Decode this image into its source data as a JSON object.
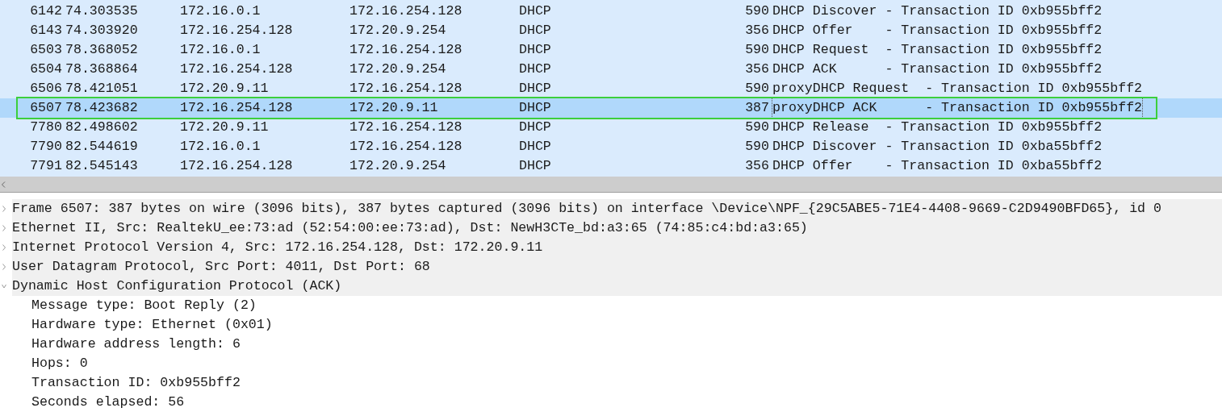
{
  "packet_list": {
    "rows": [
      {
        "no": "6142",
        "time": "74.303535",
        "source": "172.16.0.1",
        "destination": "172.16.254.128",
        "protocol": "DHCP",
        "length": "590",
        "info": "DHCP Discover - Transaction ID 0xb955bff2",
        "selected": false
      },
      {
        "no": "6143",
        "time": "74.303920",
        "source": "172.16.254.128",
        "destination": "172.20.9.254",
        "protocol": "DHCP",
        "length": "356",
        "info": "DHCP Offer    - Transaction ID 0xb955bff2",
        "selected": false
      },
      {
        "no": "6503",
        "time": "78.368052",
        "source": "172.16.0.1",
        "destination": "172.16.254.128",
        "protocol": "DHCP",
        "length": "590",
        "info": "DHCP Request  - Transaction ID 0xb955bff2",
        "selected": false
      },
      {
        "no": "6504",
        "time": "78.368864",
        "source": "172.16.254.128",
        "destination": "172.20.9.254",
        "protocol": "DHCP",
        "length": "356",
        "info": "DHCP ACK      - Transaction ID 0xb955bff2",
        "selected": false
      },
      {
        "no": "6506",
        "time": "78.421051",
        "source": "172.20.9.11",
        "destination": "172.16.254.128",
        "protocol": "DHCP",
        "length": "590",
        "info": "proxyDHCP Request  - Transaction ID 0xb955bff2",
        "selected": false
      },
      {
        "no": "6507",
        "time": "78.423682",
        "source": "172.16.254.128",
        "destination": "172.20.9.11",
        "protocol": "DHCP",
        "length": "387",
        "info": "proxyDHCP ACK      - Transaction ID 0xb955bff2",
        "selected": true
      },
      {
        "no": "7780",
        "time": "82.498602",
        "source": "172.20.9.11",
        "destination": "172.16.254.128",
        "protocol": "DHCP",
        "length": "590",
        "info": "DHCP Release  - Transaction ID 0xb955bff2",
        "selected": false
      },
      {
        "no": "7790",
        "time": "82.544619",
        "source": "172.16.0.1",
        "destination": "172.16.254.128",
        "protocol": "DHCP",
        "length": "590",
        "info": "DHCP Discover - Transaction ID 0xba55bff2",
        "selected": false
      },
      {
        "no": "7791",
        "time": "82.545143",
        "source": "172.16.254.128",
        "destination": "172.20.9.254",
        "protocol": "DHCP",
        "length": "356",
        "info": "DHCP Offer    - Transaction ID 0xba55bff2",
        "selected": false
      }
    ]
  },
  "packet_details": [
    {
      "label": "Frame 6507: 387 bytes on wire (3096 bits), 387 bytes captured (3096 bits) on interface \\Device\\NPF_{29C5ABE5-71E4-4408-9669-C2D9490BFD65}, id 0",
      "expanded": false
    },
    {
      "label": "Ethernet II, Src: RealtekU_ee:73:ad (52:54:00:ee:73:ad), Dst: NewH3CTe_bd:a3:65 (74:85:c4:bd:a3:65)",
      "expanded": false
    },
    {
      "label": "Internet Protocol Version 4, Src: 172.16.254.128, Dst: 172.20.9.11",
      "expanded": false
    },
    {
      "label": "User Datagram Protocol, Src Port: 4011, Dst Port: 68",
      "expanded": false
    },
    {
      "label": "Dynamic Host Configuration Protocol (ACK)",
      "expanded": true,
      "children": [
        {
          "label": "Message type: Boot Reply (2)"
        },
        {
          "label": "Hardware type: Ethernet (0x01)"
        },
        {
          "label": "Hardware address length: 6"
        },
        {
          "label": "Hops: 0"
        },
        {
          "label": "Transaction ID: 0xb955bff2"
        },
        {
          "label": "Seconds elapsed: 56"
        }
      ]
    }
  ]
}
